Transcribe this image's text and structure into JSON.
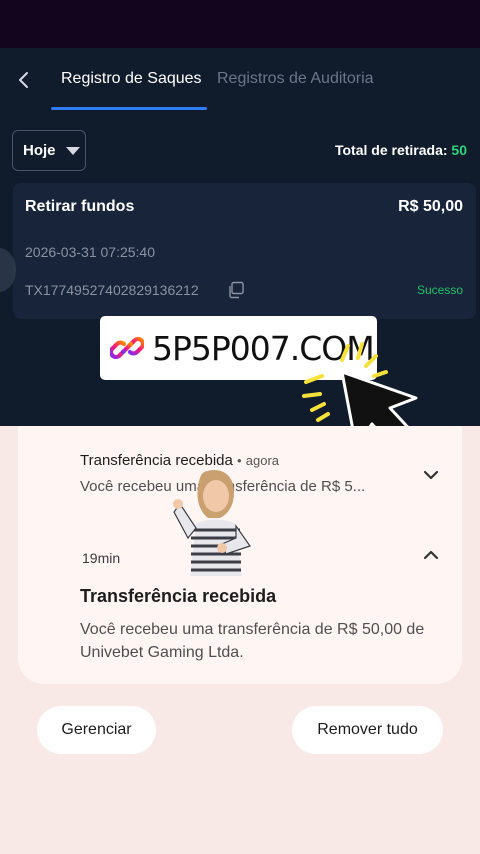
{
  "header": {
    "tabs": [
      {
        "label": "Registro de Saques",
        "active": true
      },
      {
        "label": "Registros de Auditoria",
        "active": false
      }
    ]
  },
  "filter": {
    "selected": "Hoje",
    "total_label": "Total de retirada:",
    "total_value": "50"
  },
  "record": {
    "title": "Retirar fundos",
    "amount": "R$ 50,00",
    "datetime": "2026-03-31 07:25:40",
    "tx_id": "TX17749527402829136212",
    "status": "Sucesso"
  },
  "overlay": {
    "promo_text": "5P5P007.COM"
  },
  "notifications": {
    "collapsed": {
      "title": "Transferência recebida",
      "separator": "•",
      "time": "agora",
      "body": "Você recebeu uma transferência de R$ 5..."
    },
    "expanded": {
      "time": "19min",
      "title": "Transferência recebida",
      "body": "Você recebeu uma transferência de R$ 50,00 de Univebet Gaming Ltda."
    }
  },
  "actions": {
    "manage_label": "Gerenciar",
    "clear_label": "Remover tudo"
  },
  "colors": {
    "accent_blue": "#2f7df6",
    "success_green": "#2cd67a",
    "app_bg": "#101b2c"
  }
}
